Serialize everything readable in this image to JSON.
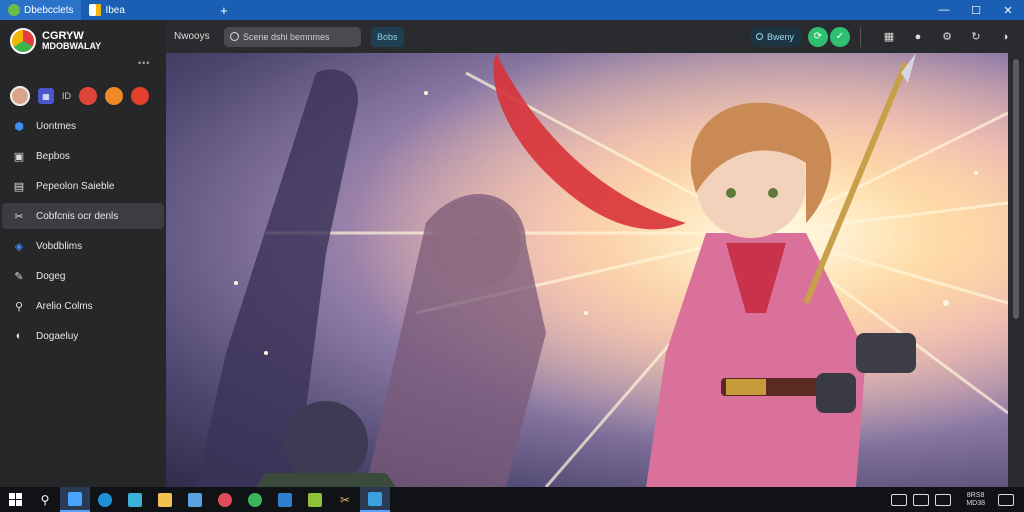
{
  "window": {
    "tabs": [
      {
        "label": "Dbebcclets",
        "active": true
      },
      {
        "label": "Ibea",
        "active": false
      }
    ],
    "new_tab": "+",
    "controls": {
      "minimize": "—",
      "maximize": "☐",
      "close": "✕"
    }
  },
  "sidebar": {
    "logo_line1": "CGRYW",
    "logo_line2": "MDOBWALAY",
    "more": "•••",
    "quick_text": "ID",
    "items": [
      {
        "label": "Uontmes",
        "icon": "shield-icon",
        "selected": false
      },
      {
        "label": "Bepbos",
        "icon": "image-icon",
        "selected": false
      },
      {
        "label": "Pepeolon Saieble",
        "icon": "gallery-icon",
        "selected": false
      },
      {
        "label": "Cobfcnis ocr denls",
        "icon": "tools-icon",
        "selected": true
      },
      {
        "label": "Vobdblims",
        "icon": "layers-icon",
        "selected": false
      },
      {
        "label": "Dogeg",
        "icon": "paint-icon",
        "selected": false
      },
      {
        "label": "Arelio Colms",
        "icon": "link-icon",
        "selected": false
      },
      {
        "label": "Dogaeluy",
        "icon": "chat-icon",
        "selected": false
      }
    ]
  },
  "toolbar": {
    "label": "Nwooys",
    "search_placeholder": "Scene dshi bemnmes",
    "button": "Bobs",
    "pill": "Bweny"
  },
  "taskbar": {
    "clock_line1": "8RS8",
    "clock_line2": "MD38"
  },
  "colors": {
    "titlebar": "#1a5fb4",
    "sidebar": "#262729",
    "accent_green": "#2fbf71",
    "accent_blue": "#3d8ef0"
  }
}
